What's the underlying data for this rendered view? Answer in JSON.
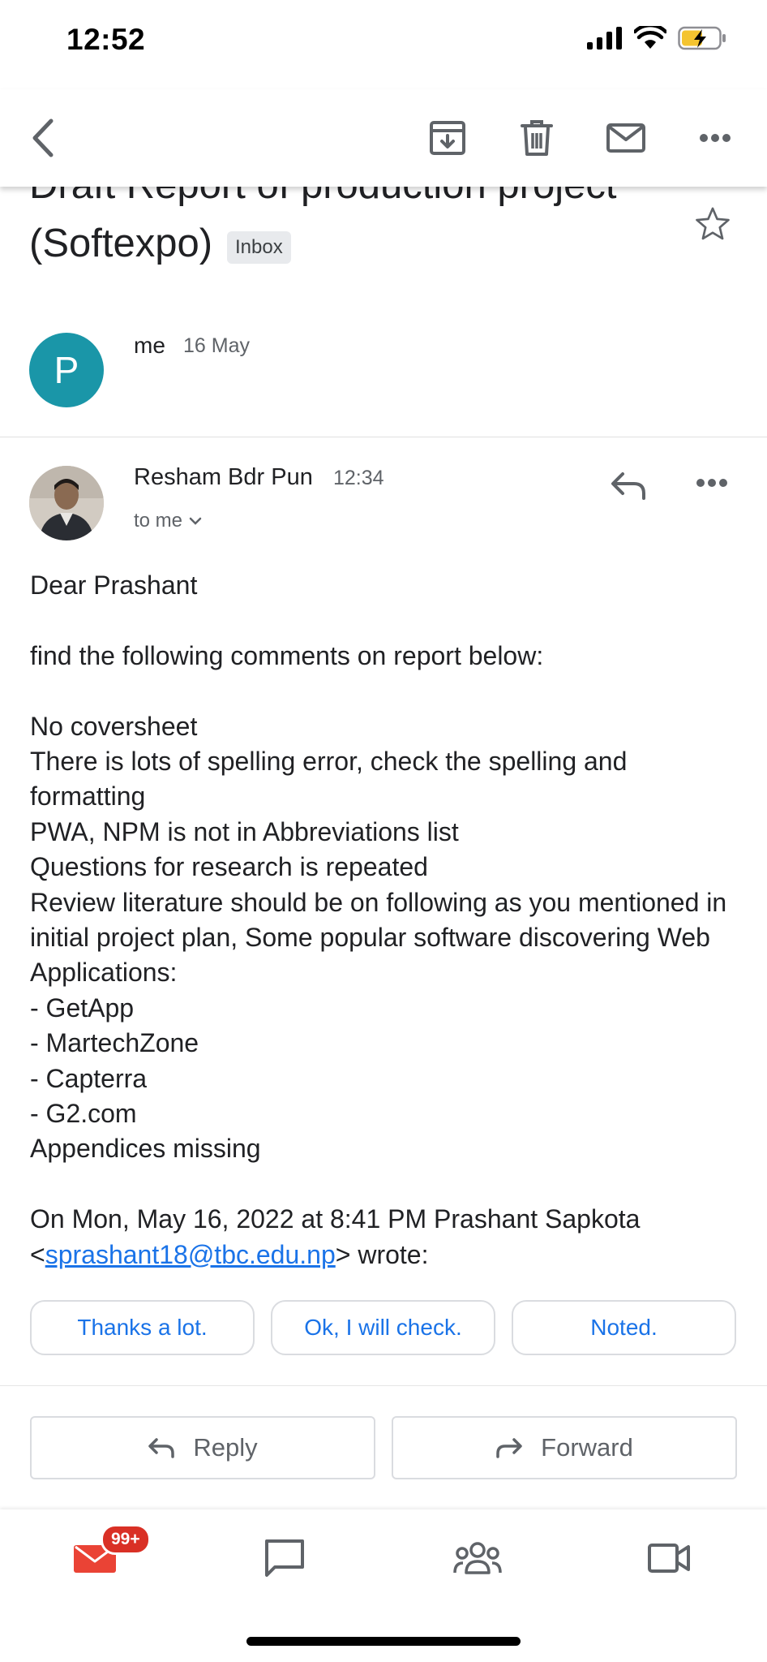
{
  "status_bar": {
    "time": "12:52"
  },
  "toolbar": {
    "back_icon": "chevron-left-icon",
    "archive_icon": "archive-icon",
    "delete_icon": "trash-icon",
    "mark_unread_icon": "mail-icon",
    "more_icon": "more-horizontal-icon"
  },
  "subject": {
    "line1": "Draft Report of production project",
    "line2": "(Softexpo)",
    "label": "Inbox"
  },
  "message1": {
    "avatar_letter": "P",
    "sender": "me",
    "date": "16 May"
  },
  "message2": {
    "sender": "Resham Bdr Pun",
    "time": "12:34",
    "to": "to me",
    "body": {
      "greeting": "Dear Prashant",
      "intro": "find the following comments on report below:",
      "lines": [
        "No coversheet",
        "There is lots of spelling error, check the spelling and formatting",
        "PWA, NPM is not in Abbreviations list",
        "Questions for research is repeated",
        "Review literature should be on following as you mentioned in initial project plan, Some popular software discovering Web Applications:",
        "- GetApp",
        "- MartechZone",
        "- Capterra",
        "- G2.com",
        "Appendices missing"
      ],
      "quote_prefix": "On Mon, May 16, 2022 at 8:41 PM Prashant Sapkota",
      "quote_lt": "<",
      "quote_email": "sprashant18@tbc.edu.np",
      "quote_suffix": "> wrote:"
    }
  },
  "smart_replies": [
    "Thanks a lot.",
    "Ok, I will check.",
    "Noted."
  ],
  "actions": {
    "reply": "Reply",
    "forward": "Forward"
  },
  "bottom_nav": {
    "mail_badge": "99+",
    "items": [
      "mail-icon",
      "chat-icon",
      "spaces-icon",
      "meet-icon"
    ]
  },
  "colors": {
    "accent": "#1a73e8",
    "badge": "#d93025",
    "mail": "#ea4335",
    "avatar": "#1a96a8"
  }
}
